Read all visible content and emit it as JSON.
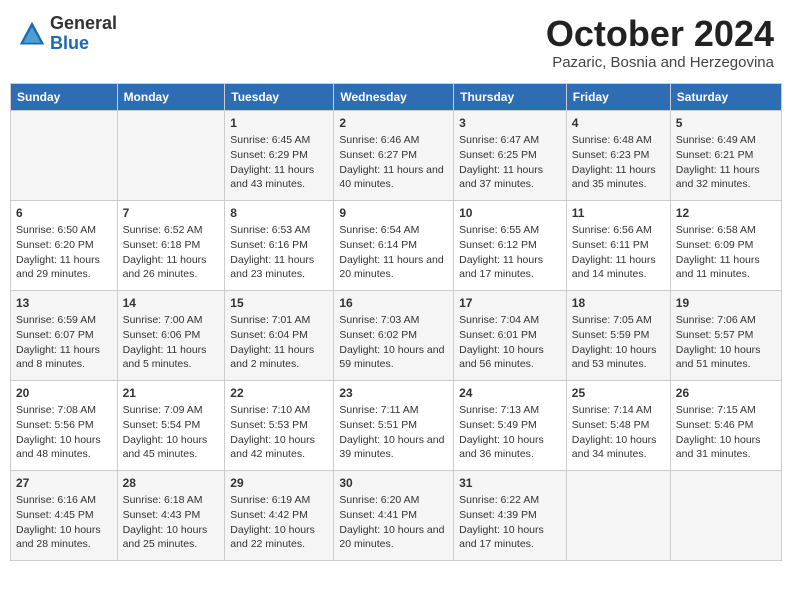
{
  "header": {
    "logo_line1": "General",
    "logo_line2": "Blue",
    "title": "October 2024",
    "location": "Pazaric, Bosnia and Herzegovina"
  },
  "days_of_week": [
    "Sunday",
    "Monday",
    "Tuesday",
    "Wednesday",
    "Thursday",
    "Friday",
    "Saturday"
  ],
  "weeks": [
    [
      {
        "day": "",
        "content": ""
      },
      {
        "day": "",
        "content": ""
      },
      {
        "day": "1",
        "content": "Sunrise: 6:45 AM\nSunset: 6:29 PM\nDaylight: 11 hours and 43 minutes."
      },
      {
        "day": "2",
        "content": "Sunrise: 6:46 AM\nSunset: 6:27 PM\nDaylight: 11 hours and 40 minutes."
      },
      {
        "day": "3",
        "content": "Sunrise: 6:47 AM\nSunset: 6:25 PM\nDaylight: 11 hours and 37 minutes."
      },
      {
        "day": "4",
        "content": "Sunrise: 6:48 AM\nSunset: 6:23 PM\nDaylight: 11 hours and 35 minutes."
      },
      {
        "day": "5",
        "content": "Sunrise: 6:49 AM\nSunset: 6:21 PM\nDaylight: 11 hours and 32 minutes."
      }
    ],
    [
      {
        "day": "6",
        "content": "Sunrise: 6:50 AM\nSunset: 6:20 PM\nDaylight: 11 hours and 29 minutes."
      },
      {
        "day": "7",
        "content": "Sunrise: 6:52 AM\nSunset: 6:18 PM\nDaylight: 11 hours and 26 minutes."
      },
      {
        "day": "8",
        "content": "Sunrise: 6:53 AM\nSunset: 6:16 PM\nDaylight: 11 hours and 23 minutes."
      },
      {
        "day": "9",
        "content": "Sunrise: 6:54 AM\nSunset: 6:14 PM\nDaylight: 11 hours and 20 minutes."
      },
      {
        "day": "10",
        "content": "Sunrise: 6:55 AM\nSunset: 6:12 PM\nDaylight: 11 hours and 17 minutes."
      },
      {
        "day": "11",
        "content": "Sunrise: 6:56 AM\nSunset: 6:11 PM\nDaylight: 11 hours and 14 minutes."
      },
      {
        "day": "12",
        "content": "Sunrise: 6:58 AM\nSunset: 6:09 PM\nDaylight: 11 hours and 11 minutes."
      }
    ],
    [
      {
        "day": "13",
        "content": "Sunrise: 6:59 AM\nSunset: 6:07 PM\nDaylight: 11 hours and 8 minutes."
      },
      {
        "day": "14",
        "content": "Sunrise: 7:00 AM\nSunset: 6:06 PM\nDaylight: 11 hours and 5 minutes."
      },
      {
        "day": "15",
        "content": "Sunrise: 7:01 AM\nSunset: 6:04 PM\nDaylight: 11 hours and 2 minutes."
      },
      {
        "day": "16",
        "content": "Sunrise: 7:03 AM\nSunset: 6:02 PM\nDaylight: 10 hours and 59 minutes."
      },
      {
        "day": "17",
        "content": "Sunrise: 7:04 AM\nSunset: 6:01 PM\nDaylight: 10 hours and 56 minutes."
      },
      {
        "day": "18",
        "content": "Sunrise: 7:05 AM\nSunset: 5:59 PM\nDaylight: 10 hours and 53 minutes."
      },
      {
        "day": "19",
        "content": "Sunrise: 7:06 AM\nSunset: 5:57 PM\nDaylight: 10 hours and 51 minutes."
      }
    ],
    [
      {
        "day": "20",
        "content": "Sunrise: 7:08 AM\nSunset: 5:56 PM\nDaylight: 10 hours and 48 minutes."
      },
      {
        "day": "21",
        "content": "Sunrise: 7:09 AM\nSunset: 5:54 PM\nDaylight: 10 hours and 45 minutes."
      },
      {
        "day": "22",
        "content": "Sunrise: 7:10 AM\nSunset: 5:53 PM\nDaylight: 10 hours and 42 minutes."
      },
      {
        "day": "23",
        "content": "Sunrise: 7:11 AM\nSunset: 5:51 PM\nDaylight: 10 hours and 39 minutes."
      },
      {
        "day": "24",
        "content": "Sunrise: 7:13 AM\nSunset: 5:49 PM\nDaylight: 10 hours and 36 minutes."
      },
      {
        "day": "25",
        "content": "Sunrise: 7:14 AM\nSunset: 5:48 PM\nDaylight: 10 hours and 34 minutes."
      },
      {
        "day": "26",
        "content": "Sunrise: 7:15 AM\nSunset: 5:46 PM\nDaylight: 10 hours and 31 minutes."
      }
    ],
    [
      {
        "day": "27",
        "content": "Sunrise: 6:16 AM\nSunset: 4:45 PM\nDaylight: 10 hours and 28 minutes."
      },
      {
        "day": "28",
        "content": "Sunrise: 6:18 AM\nSunset: 4:43 PM\nDaylight: 10 hours and 25 minutes."
      },
      {
        "day": "29",
        "content": "Sunrise: 6:19 AM\nSunset: 4:42 PM\nDaylight: 10 hours and 22 minutes."
      },
      {
        "day": "30",
        "content": "Sunrise: 6:20 AM\nSunset: 4:41 PM\nDaylight: 10 hours and 20 minutes."
      },
      {
        "day": "31",
        "content": "Sunrise: 6:22 AM\nSunset: 4:39 PM\nDaylight: 10 hours and 17 minutes."
      },
      {
        "day": "",
        "content": ""
      },
      {
        "day": "",
        "content": ""
      }
    ]
  ]
}
